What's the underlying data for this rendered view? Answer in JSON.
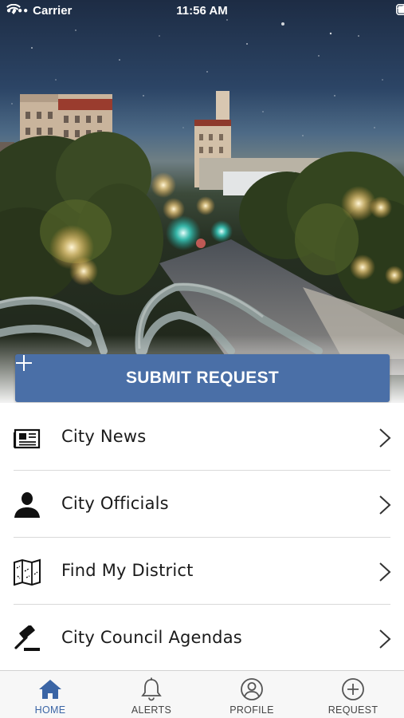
{
  "status_bar": {
    "carrier": "Carrier",
    "time": "11:56 AM",
    "signal_icon": "signal-dots-icon",
    "wifi_icon": "wifi-icon",
    "location_icon": "location-arrow-icon",
    "battery_icon": "battery-icon"
  },
  "hero": {
    "image": "night city street with bridge railings and lit buildings",
    "submit_button": {
      "label": "SUBMIT REQUEST",
      "icon": "plus-icon",
      "color": "#4a6fa7"
    }
  },
  "menu": {
    "items": [
      {
        "label": "City News",
        "icon": "newspaper-icon"
      },
      {
        "label": "City Officials",
        "icon": "person-icon"
      },
      {
        "label": "Find My District",
        "icon": "map-icon"
      },
      {
        "label": "City Council Agendas",
        "icon": "gavel-icon"
      }
    ],
    "chevron_icon": "chevron-right-icon"
  },
  "tab_bar": {
    "active_color": "#3b65a5",
    "tabs": [
      {
        "label": "HOME",
        "icon": "home-icon",
        "active": true
      },
      {
        "label": "ALERTS",
        "icon": "bell-icon",
        "active": false
      },
      {
        "label": "PROFILE",
        "icon": "profile-icon",
        "active": false
      },
      {
        "label": "REQUEST",
        "icon": "plus-circle-icon",
        "active": false
      }
    ]
  }
}
